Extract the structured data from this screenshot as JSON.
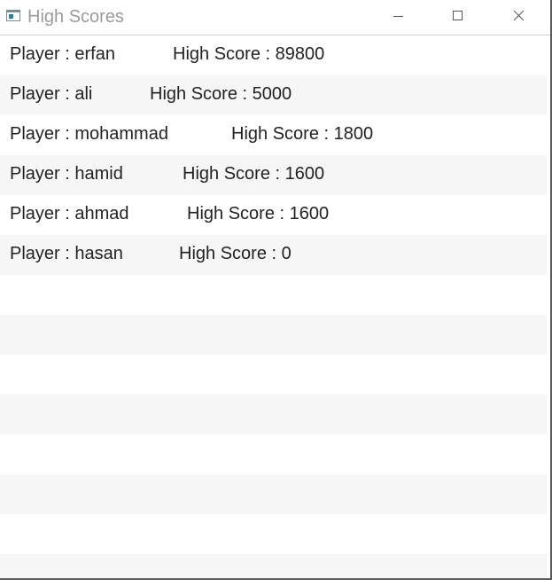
{
  "window": {
    "title": "High Scores",
    "controls": {
      "minimize": "minimize-icon",
      "maximize": "maximize-icon",
      "close": "close-icon"
    }
  },
  "scores": [
    {
      "player": "Player : erfan",
      "score": "High Score : 89800"
    },
    {
      "player": "Player : ali",
      "score": "High Score : 5000"
    },
    {
      "player": "Player : mohammad",
      "score": "High Score : 1800"
    },
    {
      "player": "Player : hamid",
      "score": "High Score : 1600"
    },
    {
      "player": "Player : ahmad",
      "score": "High Score : 1600"
    },
    {
      "player": "Player : hasan",
      "score": "High Score : 0"
    }
  ],
  "colors": {
    "row_alt": "#f6f6f6",
    "text": "#222222",
    "title_text": "#9a9a9a"
  }
}
